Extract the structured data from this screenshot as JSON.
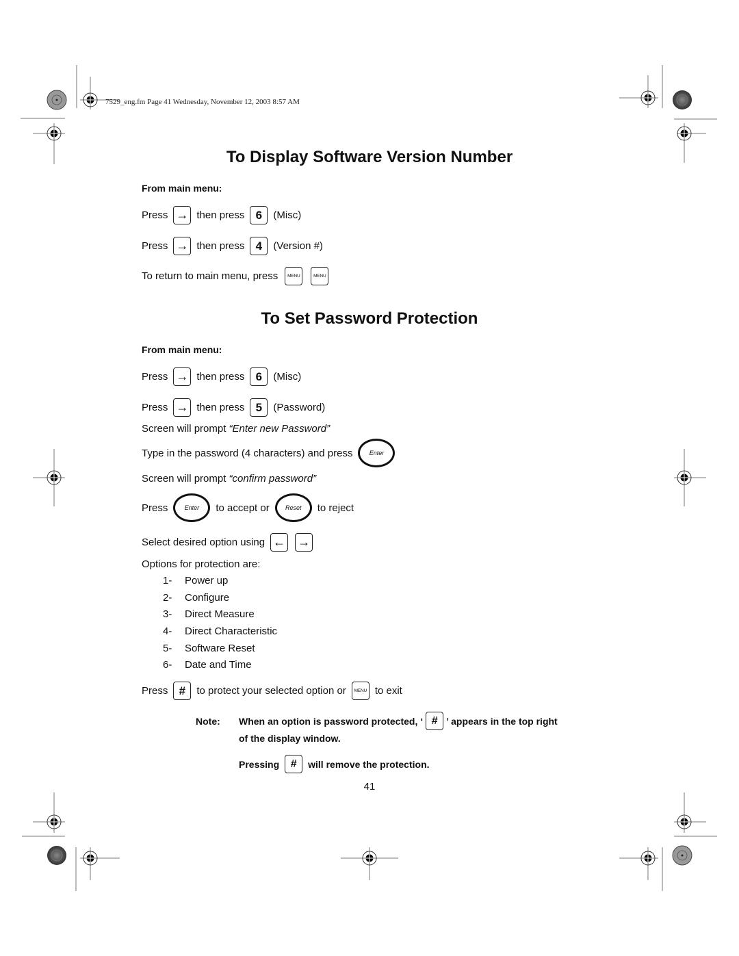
{
  "header": {
    "file_info": "7529_eng.fm  Page 41  Wednesday, November 12, 2003  8:57 AM"
  },
  "section1": {
    "title": "To Display Software Version Number",
    "subtitle": "From main menu:",
    "steps": [
      {
        "pre": "Press",
        "key1": "→",
        "mid": "then press",
        "key2": "6",
        "post": "(Misc)"
      },
      {
        "pre": "Press",
        "key1": "→",
        "mid": "then press",
        "key2": "4",
        "post": "(Version #)"
      }
    ],
    "return_text": "To return to main menu, press",
    "menu_key": "MENU"
  },
  "section2": {
    "title": "To Set Password Protection",
    "subtitle": "From main menu:",
    "steps": [
      {
        "pre": "Press",
        "key1": "→",
        "mid": "then press",
        "key2": "6",
        "post": "(Misc)"
      },
      {
        "pre": "Press",
        "key1": "→",
        "mid": "then press",
        "key2": "5",
        "post": "(Password)"
      }
    ],
    "prompt1_pre": "Screen will prompt ",
    "prompt1_quote": "“Enter new Password”",
    "type_text": "Type in the password (4 characters) and press",
    "enter_key": "Enter",
    "prompt2_pre": "Screen will prompt ",
    "prompt2_quote": "“confirm password”",
    "accept_pre": "Press",
    "accept_mid": "to accept or",
    "reset_key": "Reset",
    "accept_post": "to reject",
    "select_text": "Select desired option using",
    "left_key": "←",
    "right_key": "→",
    "options_intro": "Options for protection are:",
    "options": [
      {
        "num": "1-",
        "label": "Power up"
      },
      {
        "num": "2-",
        "label": "Configure"
      },
      {
        "num": "3-",
        "label": "Direct Measure"
      },
      {
        "num": "4-",
        "label": "Direct Characteristic"
      },
      {
        "num": "5-",
        "label": "Software Reset"
      },
      {
        "num": "6-",
        "label": "Date and Time"
      }
    ],
    "protect_pre": "Press",
    "hash_key": "#",
    "protect_mid": "to protect your selected option or",
    "protect_post": "to exit",
    "note": {
      "label": "Note:",
      "line1_pre": "When an option is password protected, ‘",
      "line1_post": "’ appears in the top right",
      "line2": "of the display window.",
      "line3_pre": "Pressing",
      "line3_post": "will remove the protection."
    }
  },
  "page_number": "41"
}
